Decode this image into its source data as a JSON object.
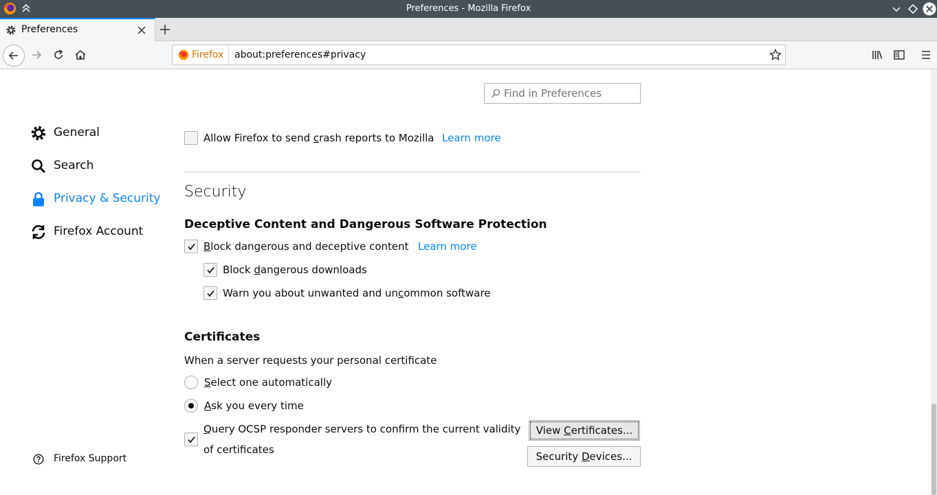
{
  "window": {
    "title": "Preferences - Mozilla Firefox"
  },
  "tab": {
    "label": "Preferences"
  },
  "urlbar": {
    "identity": "Firefox",
    "url": "about:preferences#privacy"
  },
  "search": {
    "placeholder": "Find in Preferences"
  },
  "sidebar": {
    "items": [
      {
        "label": "General",
        "icon": "gear-icon"
      },
      {
        "label": "Search",
        "icon": "search-icon"
      },
      {
        "label": "Privacy & Security",
        "icon": "lock-icon"
      },
      {
        "label": "Firefox Account",
        "icon": "sync-icon"
      }
    ],
    "support": "Firefox Support"
  },
  "crash": {
    "label_pre": "Allow Firefox to send ",
    "label_key": "c",
    "label_post": "rash reports to Mozilla",
    "checked": false,
    "learn_more": "Learn more"
  },
  "security": {
    "heading": "Security",
    "deceptive": {
      "heading": "Deceptive Content and Dangerous Software Protection",
      "block": {
        "key": "B",
        "rest": "lock dangerous and deceptive content",
        "learn_more": "Learn more",
        "checked": true
      },
      "downloads": {
        "pre": "Block ",
        "key": "d",
        "post": "angerous downloads",
        "checked": true
      },
      "unwanted": {
        "pre": "Warn you about unwanted and un",
        "key": "c",
        "post": "ommon software",
        "checked": true
      }
    },
    "certificates": {
      "heading": "Certificates",
      "prompt": "When a server requests your personal certificate",
      "auto": {
        "key": "S",
        "rest": "elect one automatically",
        "selected": false
      },
      "ask": {
        "key": "A",
        "rest": "sk you every time",
        "selected": true
      },
      "ocsp": {
        "key": "Q",
        "line1": "uery OCSP responder servers to confirm the current validity",
        "line2": "of certificates",
        "checked": true
      },
      "view_btn": {
        "pre": "View ",
        "key": "C",
        "post": "ertificates..."
      },
      "devices_btn": {
        "pre": "Security ",
        "key": "D",
        "post": "evices..."
      }
    }
  },
  "colors": {
    "accent": "#0a84ff",
    "titlebar": "#475057"
  }
}
